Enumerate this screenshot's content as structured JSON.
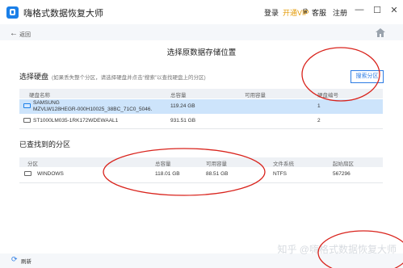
{
  "app": {
    "title": "嗨格式数据恢复大师"
  },
  "topbar": {
    "login": "登录",
    "vip": "开通VIP",
    "service": "客服",
    "register": "注册",
    "minimize": "—",
    "maximize": "☐",
    "close": "✕"
  },
  "nav": {
    "back_label": "返回"
  },
  "page": {
    "title": "选择原数据存储位置"
  },
  "disk_section": {
    "title": "选择硬盘",
    "hint": "(如果丢失整个分区，请选择硬盘并点击“搜索”以查找硬盘上的分区)",
    "search_button": "搜索分区",
    "columns": [
      "硬盘名称",
      "总容量",
      "可用容量",
      "硬盘编号"
    ],
    "rows": [
      {
        "name_line1": "SAMSUNG",
        "name_line2": "MZVLW128HEGR-000H10025_38BC_71C0_5046.",
        "total": "119.24 GB",
        "free": "",
        "number": "1"
      },
      {
        "name_line1": "ST1000LM035-1RK172WDEWAAL1",
        "name_line2": "",
        "total": "931.51 GB",
        "free": "",
        "number": "2"
      }
    ]
  },
  "partition_section": {
    "title": "已查找到的分区",
    "columns": [
      "分区",
      "总容量",
      "可用容量",
      "文件系统",
      "起始扇区"
    ],
    "rows": [
      {
        "name": "WINDOWS",
        "total": "118.01 GB",
        "free": "88.51 GB",
        "fs": "NTFS",
        "start": "567296"
      }
    ]
  },
  "footer": {
    "refresh": "刷新"
  },
  "watermark": "知乎 @嗨格式数据恢复大师",
  "colors": {
    "accent": "#2b7be4",
    "selected_row": "#cde4fb",
    "vip": "#e39a06",
    "annotation": "#d9231c"
  }
}
